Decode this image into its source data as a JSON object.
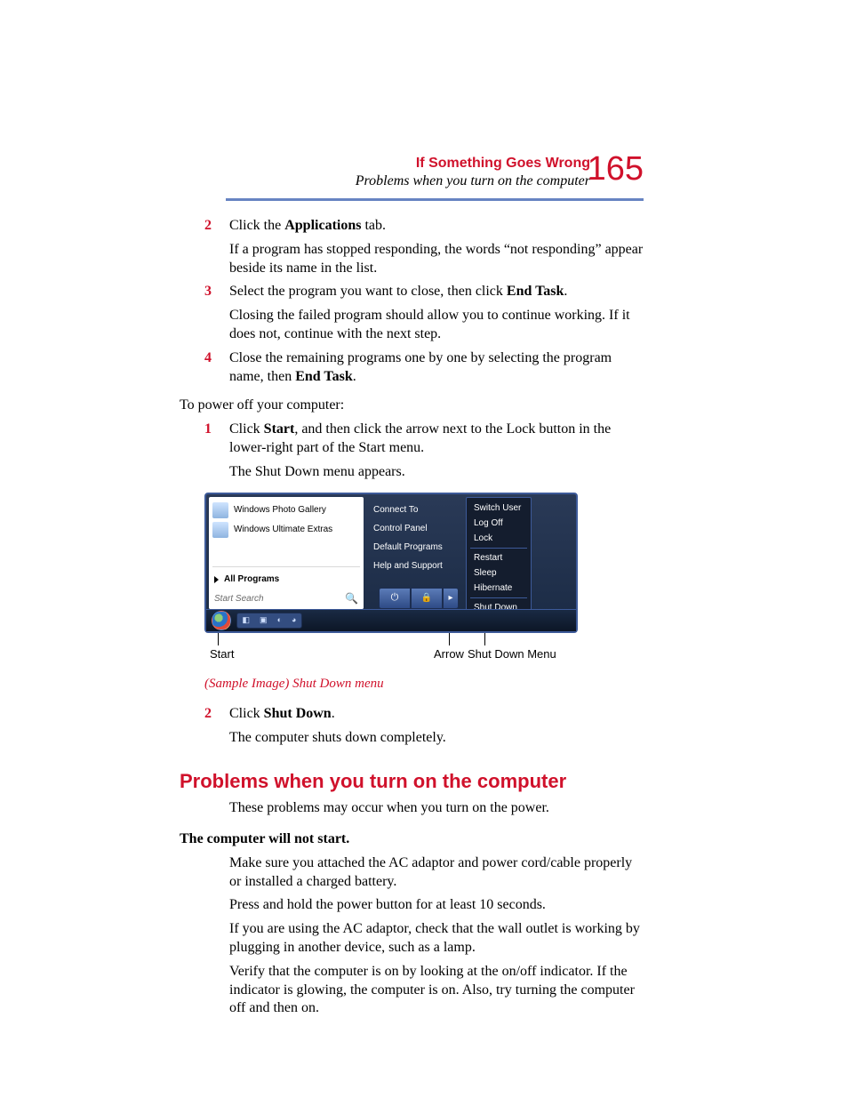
{
  "header": {
    "chapter": "If Something Goes Wrong",
    "subtitle": "Problems when you turn on the computer",
    "page_number": "165"
  },
  "steps_a": {
    "s2_num": "2",
    "s2_a": "Click the ",
    "s2_b": "Applications",
    "s2_c": " tab.",
    "s2_p": "If a program has stopped responding, the words “not responding” appear beside its name in the list.",
    "s3_num": "3",
    "s3_a": "Select the program you want to close, then click ",
    "s3_b": "End Task",
    "s3_c": ".",
    "s3_p": "Closing the failed program should allow you to continue working. If it does not, continue with the next step.",
    "s4_num": "4",
    "s4_a": "Close the remaining programs one by one by selecting the program name, then ",
    "s4_b": "End Task",
    "s4_c": "."
  },
  "poweroff_intro": "To power off your computer:",
  "steps_b": {
    "s1_num": "1",
    "s1_a": "Click ",
    "s1_b": "Start",
    "s1_c": ", and then click the arrow next to the Lock button in the lower-right part of the Start menu.",
    "s1_p": "The Shut Down menu appears."
  },
  "startmenu": {
    "left": {
      "photo_gallery": "Windows Photo Gallery",
      "ultimate_extras": "Windows Ultimate Extras",
      "all_programs": "All Programs",
      "search_placeholder": "Start Search"
    },
    "right": {
      "connect_to": "Connect To",
      "control_panel": "Control Panel",
      "default_programs": "Default Programs",
      "help_support": "Help and Support"
    },
    "shutdown": {
      "switch_user": "Switch User",
      "log_off": "Log Off",
      "lock": "Lock",
      "restart": "Restart",
      "sleep": "Sleep",
      "hibernate": "Hibernate",
      "shut_down": "Shut Down"
    }
  },
  "annotations": {
    "start": "Start",
    "arrow": "Arrow",
    "menu": "Shut Down Menu"
  },
  "figure_caption": "(Sample Image) Shut Down menu",
  "steps_c": {
    "s2_num": "2",
    "s2_a": "Click ",
    "s2_b": "Shut Down",
    "s2_c": ".",
    "s2_p": "The computer shuts down completely."
  },
  "h2": "Problems when you turn on the computer",
  "h2_p": "These problems may occur when you turn on the power.",
  "h3": "The computer will not start.",
  "body": {
    "p1": "Make sure you attached the AC adaptor and power cord/cable properly or installed a charged battery.",
    "p2": "Press and hold the power button for at least 10 seconds.",
    "p3": "If you are using the AC adaptor, check that the wall outlet is working by plugging in another device, such as a lamp.",
    "p4": "Verify that the computer is on by looking at the on/off indicator. If the indicator is glowing, the computer is on. Also, try turning the computer off and then on."
  }
}
